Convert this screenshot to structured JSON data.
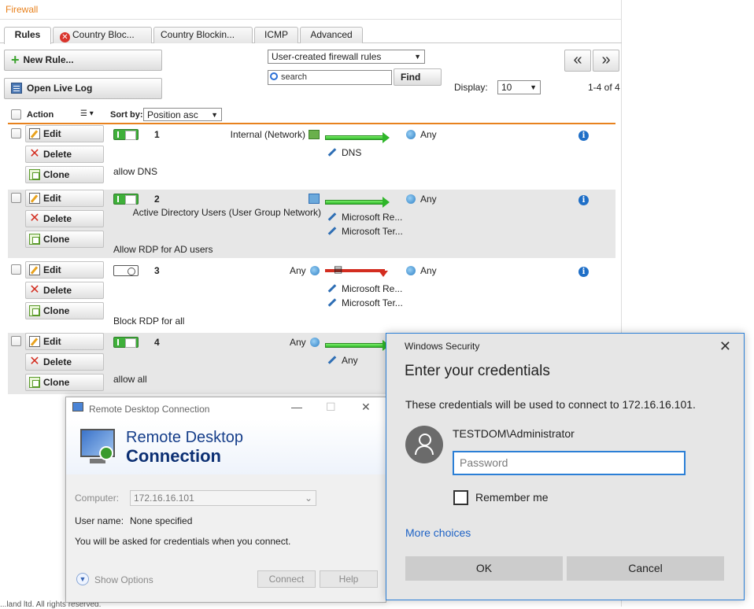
{
  "firewall": {
    "title": "Firewall",
    "tabs": [
      {
        "label": "Rules"
      },
      {
        "label": "Country Bloc..."
      },
      {
        "label": "Country Blockin..."
      },
      {
        "label": "ICMP"
      },
      {
        "label": "Advanced"
      }
    ],
    "new_rule_label": "New Rule...",
    "open_live_log_label": "Open Live Log",
    "filter_select": "User-created firewall rules",
    "search_placeholder": "search",
    "find_label": "Find",
    "display_label": "Display:",
    "display_value": "10",
    "range_text": "1-4 of 4",
    "prev_label": "«",
    "next_label": "»",
    "header": {
      "action": "Action",
      "sort_by": "Sort by:",
      "sort_value": "Position asc"
    },
    "buttons": {
      "edit": "Edit",
      "delete": "Delete",
      "clone": "Clone"
    },
    "rules": [
      {
        "num": "1",
        "source": "Internal (Network)",
        "services": [
          "DNS"
        ],
        "dest": "Any",
        "comment": "allow DNS",
        "enabled": true,
        "action": "allow"
      },
      {
        "num": "2",
        "source": "Active Directory Users (User Group Network)",
        "services": [
          "Microsoft Re...",
          "Microsoft Ter..."
        ],
        "dest": "Any",
        "comment": "Allow RDP for AD users",
        "enabled": true,
        "action": "allow"
      },
      {
        "num": "3",
        "source": "Any",
        "services": [
          "Microsoft Re...",
          "Microsoft Ter..."
        ],
        "dest": "Any",
        "comment": "Block RDP for all",
        "enabled": false,
        "action": "block"
      },
      {
        "num": "4",
        "source": "Any",
        "services": [
          "Any"
        ],
        "dest": "",
        "comment": "allow all",
        "enabled": true,
        "action": "allow"
      }
    ],
    "footer": "...land ltd. All rights reserved."
  },
  "rdc": {
    "window_title": "Remote Desktop Connection",
    "heading_line1": "Remote Desktop",
    "heading_line2": "Connection",
    "computer_label": "Computer:",
    "computer_value": "172.16.16.101",
    "username_label": "User name:",
    "username_value": "None specified",
    "info_text": "You will be asked for credentials when you connect.",
    "show_options": "Show Options",
    "connect_label": "Connect",
    "help_label": "Help"
  },
  "winsec": {
    "window_title": "Windows Security",
    "heading": "Enter your credentials",
    "description": "These credentials will be used to connect to 172.16.16.101.",
    "username": "TESTDOM\\Administrator",
    "password_placeholder": "Password",
    "remember_label": "Remember me",
    "more_choices": "More choices",
    "ok_label": "OK",
    "cancel_label": "Cancel"
  },
  "colors": {
    "accent": "#e8821e",
    "allow": "#2fb62a",
    "block": "#d32d20",
    "win_blue": "#2b7fd6"
  }
}
